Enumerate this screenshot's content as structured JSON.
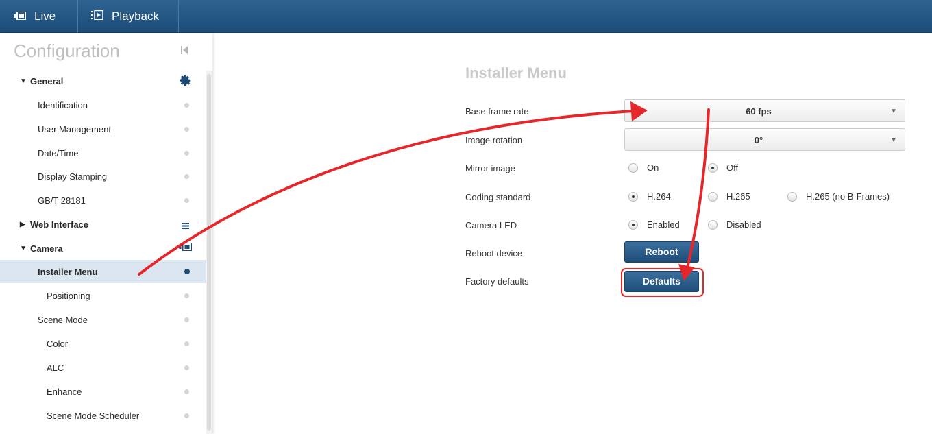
{
  "topbar": {
    "tabs": [
      {
        "label": "Live",
        "icon": "live-camera-icon"
      },
      {
        "label": "Playback",
        "icon": "playback-icon"
      }
    ]
  },
  "sidebar": {
    "title": "Configuration",
    "collapse_icon": "collapse-left-icon",
    "items": [
      {
        "label": "General",
        "type": "category",
        "expanded": true,
        "icon": "gear-icon"
      },
      {
        "label": "Identification",
        "type": "item"
      },
      {
        "label": "User Management",
        "type": "item"
      },
      {
        "label": "Date/Time",
        "type": "item"
      },
      {
        "label": "Display Stamping",
        "type": "item"
      },
      {
        "label": "GB/T 28181",
        "type": "item"
      },
      {
        "label": "Web Interface",
        "type": "category",
        "expanded": false,
        "icon": "list-icon"
      },
      {
        "label": "Camera",
        "type": "category",
        "expanded": true,
        "icon": "camera-icon"
      },
      {
        "label": "Installer Menu",
        "type": "item",
        "active": true
      },
      {
        "label": "Positioning",
        "type": "subitem"
      },
      {
        "label": "Scene Mode",
        "type": "item"
      },
      {
        "label": "Color",
        "type": "subitem"
      },
      {
        "label": "ALC",
        "type": "subitem"
      },
      {
        "label": "Enhance",
        "type": "subitem"
      },
      {
        "label": "Scene Mode Scheduler",
        "type": "subitem"
      }
    ]
  },
  "main": {
    "title": "Installer Menu",
    "base_frame_rate": {
      "label": "Base frame rate",
      "value": "60 fps"
    },
    "image_rotation": {
      "label": "Image rotation",
      "value": "0°"
    },
    "mirror_image": {
      "label": "Mirror image",
      "options": [
        "On",
        "Off"
      ],
      "selected": "Off"
    },
    "coding_standard": {
      "label": "Coding standard",
      "options": [
        "H.264",
        "H.265",
        "H.265 (no B-Frames)"
      ],
      "selected": "H.264"
    },
    "camera_led": {
      "label": "Camera LED",
      "options": [
        "Enabled",
        "Disabled"
      ],
      "selected": "Enabled"
    },
    "reboot": {
      "label": "Reboot device",
      "button": "Reboot"
    },
    "factory": {
      "label": "Factory defaults",
      "button": "Defaults"
    }
  },
  "colors": {
    "topbar": "#25598a",
    "button": "#2a5c8a",
    "active_row": "#dbe6f1",
    "annotation": "#e5262a"
  }
}
